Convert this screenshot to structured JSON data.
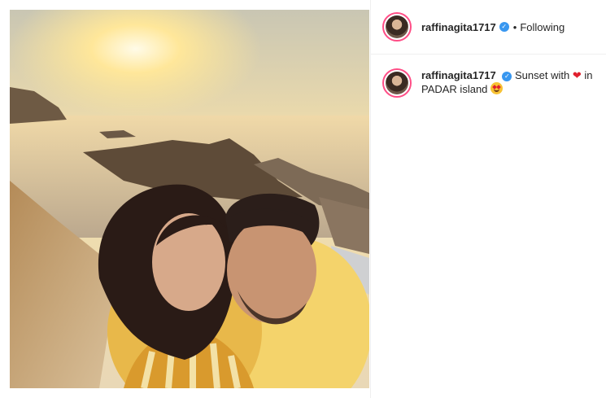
{
  "post": {
    "username": "raffinagita1717",
    "verified_icon": "verified-badge-icon",
    "separator": "•",
    "follow_status": "Following",
    "caption": {
      "text_before": "Sunset with",
      "heart": "❤",
      "text_after": "in PADAR island",
      "emoji_icon": "heart-eyes-emoji-icon"
    }
  },
  "colors": {
    "story_ring": "#ff4d86",
    "verified": "#3897f0",
    "text": "#262626"
  }
}
